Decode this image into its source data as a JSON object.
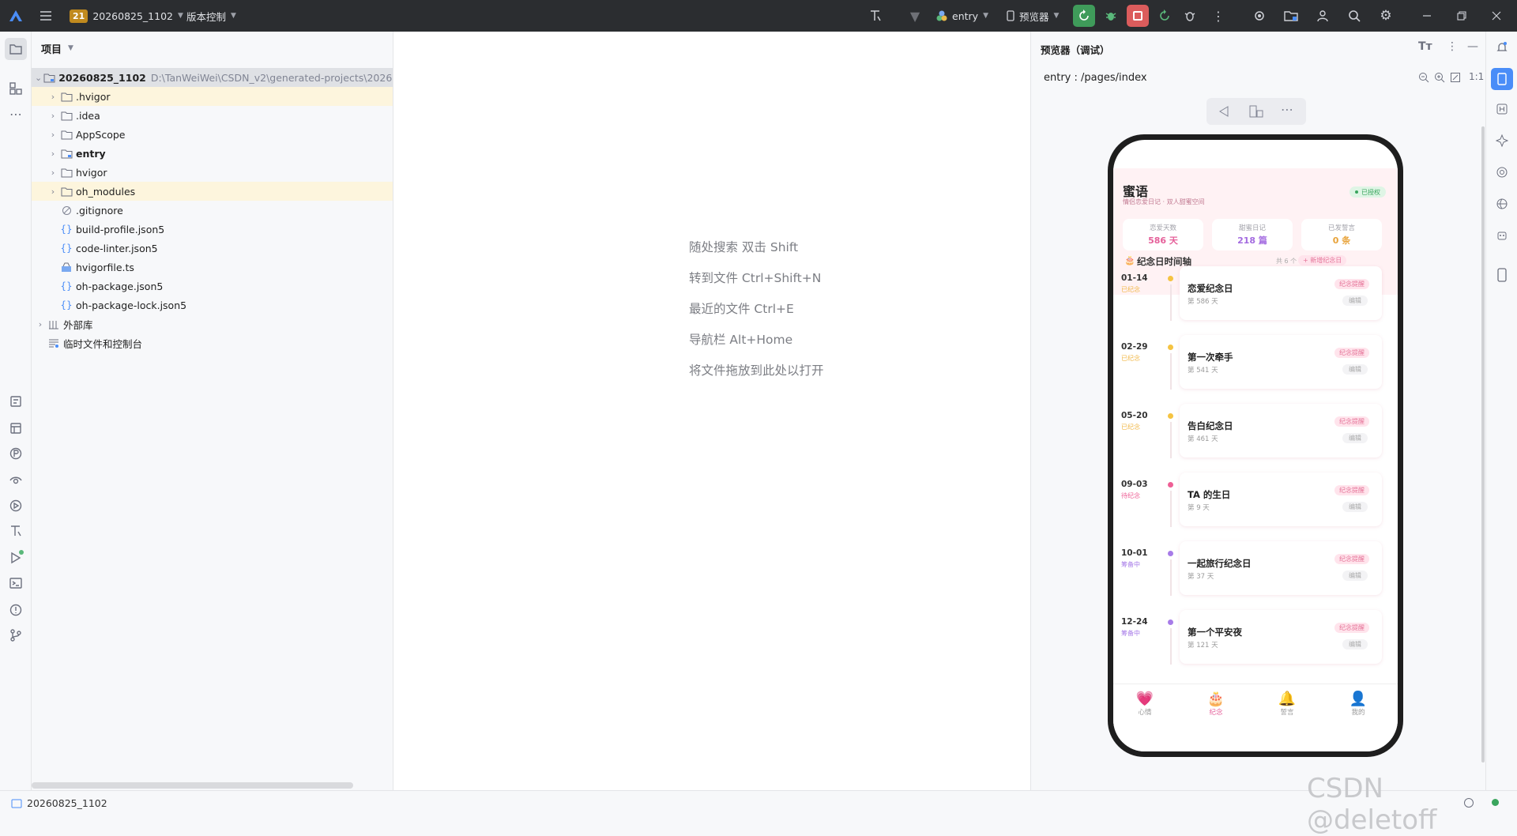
{
  "topbar": {
    "project_badge": "21",
    "project_name": "20260825_1102",
    "vcs": "版本控制",
    "run_config": "entry",
    "device": "预览器"
  },
  "project_panel": {
    "title": "项目",
    "root": {
      "name": "20260825_1102",
      "path": "D:\\TanWeiWei\\CSDN_v2\\generated-projects\\2026082"
    },
    "items": [
      {
        "label": ".hvigor",
        "type": "folder"
      },
      {
        "label": ".idea",
        "type": "folder"
      },
      {
        "label": "AppScope",
        "type": "folder"
      },
      {
        "label": "entry",
        "type": "module"
      },
      {
        "label": "hvigor",
        "type": "folder"
      },
      {
        "label": "oh_modules",
        "type": "folder"
      },
      {
        "label": ".gitignore",
        "type": "ignore"
      },
      {
        "label": "build-profile.json5",
        "type": "json"
      },
      {
        "label": "code-linter.json5",
        "type": "json"
      },
      {
        "label": "hvigorfile.ts",
        "type": "ts"
      },
      {
        "label": "oh-package.json5",
        "type": "json"
      },
      {
        "label": "oh-package-lock.json5",
        "type": "json"
      }
    ],
    "external": "外部库",
    "scratch": "临时文件和控制台"
  },
  "editor_hints": [
    "随处搜索 双击 Shift",
    "转到文件 Ctrl+Shift+N",
    "最近的文件 Ctrl+E",
    "导航栏 Alt+Home",
    "将文件拖放到此处以打开"
  ],
  "previewer": {
    "title": "预览器（调试）",
    "route": "entry : /pages/index",
    "zoom_label": "1:1"
  },
  "app": {
    "title": "蜜语",
    "subtitle": "情侣恋爱日记 · 双人甜蜜空间",
    "badge": "已授权",
    "stats": [
      {
        "label": "恋爱天数",
        "value": "586 天",
        "color": "#e5609a"
      },
      {
        "label": "甜蜜日记",
        "value": "218 篇",
        "color": "#a36be0"
      },
      {
        "label": "已发誓言",
        "value": "0 条",
        "color": "#e8a33a"
      }
    ],
    "section_title": "纪念日时间轴",
    "section_count": "共 6 个",
    "section_add": "+ 新增纪念日",
    "timeline": [
      {
        "date": "01-14",
        "status": "已纪念",
        "name": "恋爱纪念日",
        "days": "第 586 天",
        "tag": "纪念提醒",
        "edit": "编辑",
        "dot": "#f5c342",
        "status_color": "#f1b84a"
      },
      {
        "date": "02-29",
        "status": "已纪念",
        "name": "第一次牵手",
        "days": "第 541 天",
        "tag": "纪念提醒",
        "edit": "编辑",
        "dot": "#f5c342",
        "status_color": "#f1b84a"
      },
      {
        "date": "05-20",
        "status": "已纪念",
        "name": "告白纪念日",
        "days": "第 461 天",
        "tag": "纪念提醒",
        "edit": "编辑",
        "dot": "#f5c342",
        "status_color": "#f1b84a"
      },
      {
        "date": "09-03",
        "status": "待纪念",
        "name": "TA 的生日",
        "days": "第 9 天",
        "tag": "纪念提醒",
        "edit": "编辑",
        "dot": "#ee5f95",
        "status_color": "#ee5f95"
      },
      {
        "date": "10-01",
        "status": "筹备中",
        "name": "一起旅行纪念日",
        "days": "第 37 天",
        "tag": "纪念提醒",
        "edit": "编辑",
        "dot": "#a77be8",
        "status_color": "#a77be8"
      },
      {
        "date": "12-24",
        "status": "筹备中",
        "name": "第一个平安夜",
        "days": "第 121 天",
        "tag": "纪念提醒",
        "edit": "编辑",
        "dot": "#a77be8",
        "status_color": "#a77be8"
      }
    ],
    "nav": [
      {
        "icon": "💗",
        "label": "心情"
      },
      {
        "icon": "🎂",
        "label": "纪念"
      },
      {
        "icon": "🔔",
        "label": "誓言"
      },
      {
        "icon": "👤",
        "label": "我的"
      }
    ]
  },
  "statusbar": {
    "project": "20260825_1102"
  },
  "watermark": "CSDN @deletoff"
}
